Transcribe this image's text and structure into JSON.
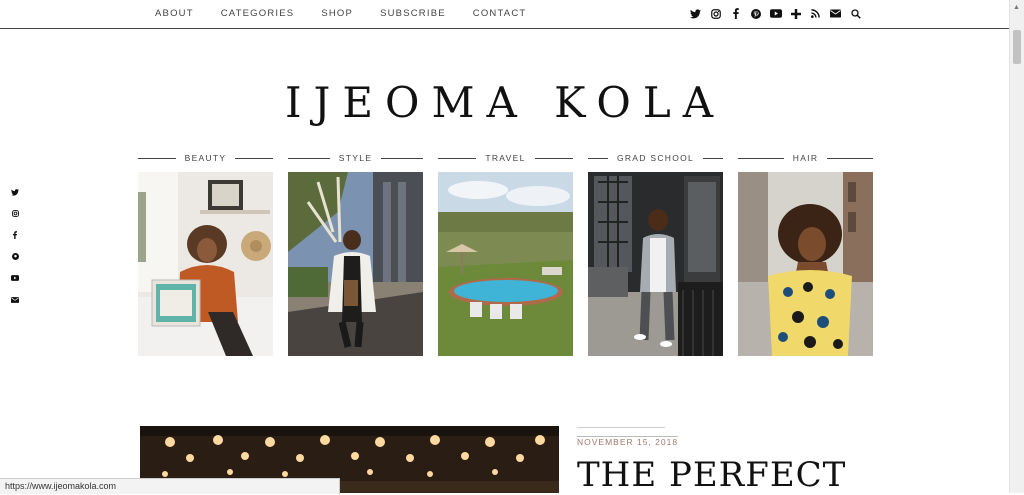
{
  "nav": {
    "items": [
      "ABOUT",
      "CATEGORIES",
      "SHOP",
      "SUBSCRIBE",
      "CONTACT"
    ],
    "social_icons": [
      "twitter-icon",
      "instagram-icon",
      "facebook-icon",
      "pinterest-icon",
      "youtube-icon",
      "bloglovin-icon",
      "rss-icon",
      "email-icon",
      "search-icon"
    ]
  },
  "site": {
    "title": "IJEOMA KOLA"
  },
  "sidebar_social": [
    "twitter-icon",
    "instagram-icon",
    "facebook-icon",
    "pinterest-icon",
    "youtube-icon",
    "email-icon"
  ],
  "categories": [
    {
      "label": "BEAUTY"
    },
    {
      "label": "STYLE"
    },
    {
      "label": "TRAVEL"
    },
    {
      "label": "GRAD SCHOOL"
    },
    {
      "label": "HAIR"
    }
  ],
  "post": {
    "date": "NOVEMBER 15, 2018",
    "title": "THE PERFECT"
  },
  "status_bar": {
    "url": "https://www.ijeomakola.com"
  },
  "colors": {
    "accent": "#a0796b",
    "text": "#222222",
    "rule": "#444444"
  }
}
